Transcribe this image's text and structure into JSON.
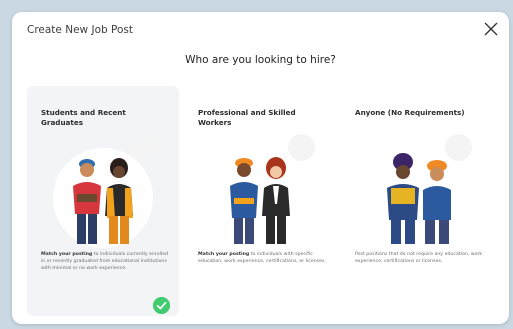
{
  "modal": {
    "title": "Create New Job Post",
    "question": "Who are you looking to hire?"
  },
  "options": [
    {
      "title": "Students and Recent Graduates",
      "desc_bold": "Match your posting",
      "desc_rest": " to individuals currently enrolled in or recently graduated from educational institutions with minimal or no work experience.",
      "selected": true
    },
    {
      "title": "Professional and Skilled Workers",
      "desc_bold": "Match your posting",
      "desc_rest": " to individuals with specific education, work experience, certifications, or licenses.",
      "selected": false
    },
    {
      "title": "Anyone (No Requirements)",
      "desc_bold": "",
      "desc_rest": "Post positions that do not require any education, work experience, certifications or licenses.",
      "selected": false
    }
  ],
  "colors": {
    "backdrop": "#c9d8e2",
    "selected_card": "#f3f4f5",
    "check": "#3fcb6e"
  },
  "icons": [
    "close-icon",
    "students-illustration",
    "professionals-illustration",
    "anyone-illustration",
    "check-icon"
  ]
}
